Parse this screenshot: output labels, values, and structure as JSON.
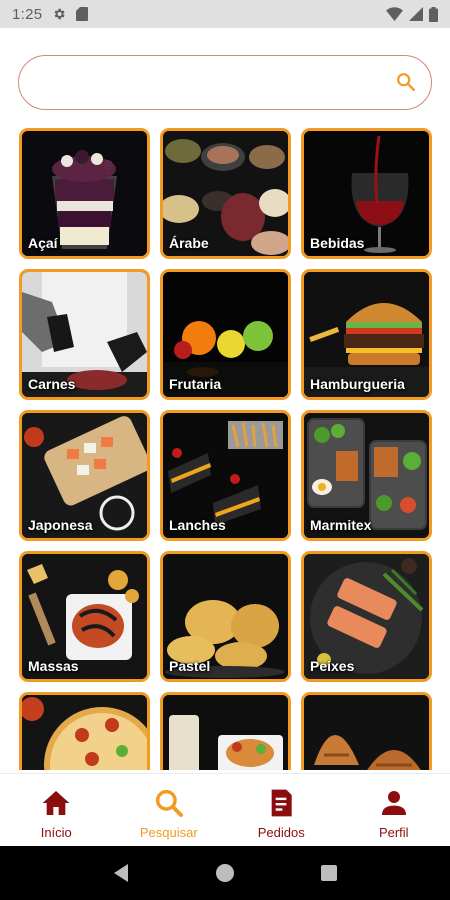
{
  "status_bar": {
    "time": "1:25",
    "icons": [
      "gear-icon",
      "sd-card-icon",
      "wifi-icon",
      "signal-icon",
      "battery-icon"
    ]
  },
  "search": {
    "placeholder": "",
    "value": "",
    "icon": "search-icon",
    "border_color": "#d4857c",
    "icon_color": "#f29b22"
  },
  "categories": [
    {
      "label": "Açaí"
    },
    {
      "label": "Árabe"
    },
    {
      "label": "Bebidas"
    },
    {
      "label": "Carnes"
    },
    {
      "label": "Frutaria"
    },
    {
      "label": "Hamburgueria"
    },
    {
      "label": "Japonesa"
    },
    {
      "label": "Lanches"
    },
    {
      "label": "Marmitex"
    },
    {
      "label": "Massas"
    },
    {
      "label": "Pastel"
    },
    {
      "label": "Peixes"
    },
    {
      "label": ""
    },
    {
      "label": ""
    },
    {
      "label": ""
    }
  ],
  "tile_border_color": "#f29b22",
  "bottom_nav": {
    "items": [
      {
        "label": "Início",
        "icon": "home-icon"
      },
      {
        "label": "Pesquisar",
        "icon": "search-icon",
        "active": true
      },
      {
        "label": "Pedidos",
        "icon": "receipt-icon"
      },
      {
        "label": "Perfil",
        "icon": "person-icon"
      }
    ],
    "active_color": "#f29b22",
    "inactive_color": "#8b0e0e"
  },
  "system_nav": {
    "icons": [
      "back-icon",
      "home-circle-icon",
      "recents-icon"
    ]
  }
}
